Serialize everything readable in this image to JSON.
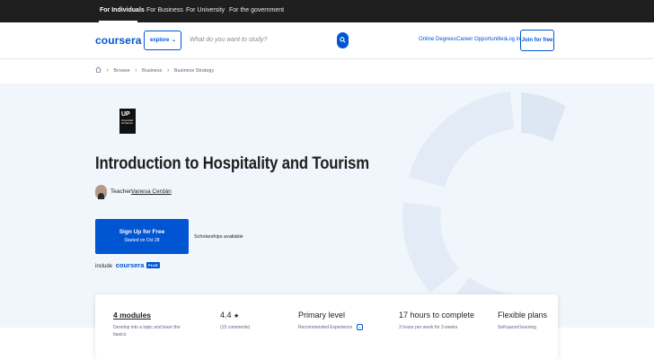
{
  "topnav": {
    "items": [
      {
        "label": "For Individuals",
        "active": true
      },
      {
        "label": "For Business",
        "active": false
      },
      {
        "label": "For University",
        "active": false
      },
      {
        "label": "For the government",
        "active": false
      }
    ]
  },
  "header": {
    "logo": "coursera",
    "explore_label": "explore",
    "search_placeholder": "What do you want to study?",
    "links": {
      "online_degrees": "Online Degrees",
      "career_opportunities": "Career Opportunities",
      "login": "Log in",
      "join": "Join for free"
    }
  },
  "breadcrumb": {
    "items": [
      "Browse",
      "Business",
      "Business Strategy"
    ]
  },
  "course": {
    "partner_logo": "UP",
    "partner_logo_sub": "Universidad de Palermo",
    "title": "Introduction to Hospitality and Tourism",
    "teacher_label": "Teacher:",
    "teacher_name": "Vanesa Cerdán",
    "signup_main": "Sign Up for Free",
    "signup_sub": "Started on Oct 28",
    "scholarships": "Scholarships available",
    "plus_prefix": "include",
    "plus_logo": "coursera",
    "plus_badge": "PLUS"
  },
  "info": {
    "modules": {
      "title": "4 modules",
      "sub1": "Develop into a topic and learn the",
      "sub2": "basics."
    },
    "rating": {
      "value": "4.4",
      "star": "★",
      "sub": "(15 comments)"
    },
    "level": {
      "title": "Primary level",
      "sub": "Recommended Experience",
      "icon": "i"
    },
    "hours": {
      "title": "17 hours to complete",
      "sub": "3 hours per week for 3 weeks"
    },
    "plans": {
      "title": "Flexible plans",
      "sub": "Self-paced learning"
    }
  },
  "colors": {
    "brand": "#0056d2",
    "topbar": "#1f1f1f",
    "hero_bg": "#f0f6fc"
  }
}
